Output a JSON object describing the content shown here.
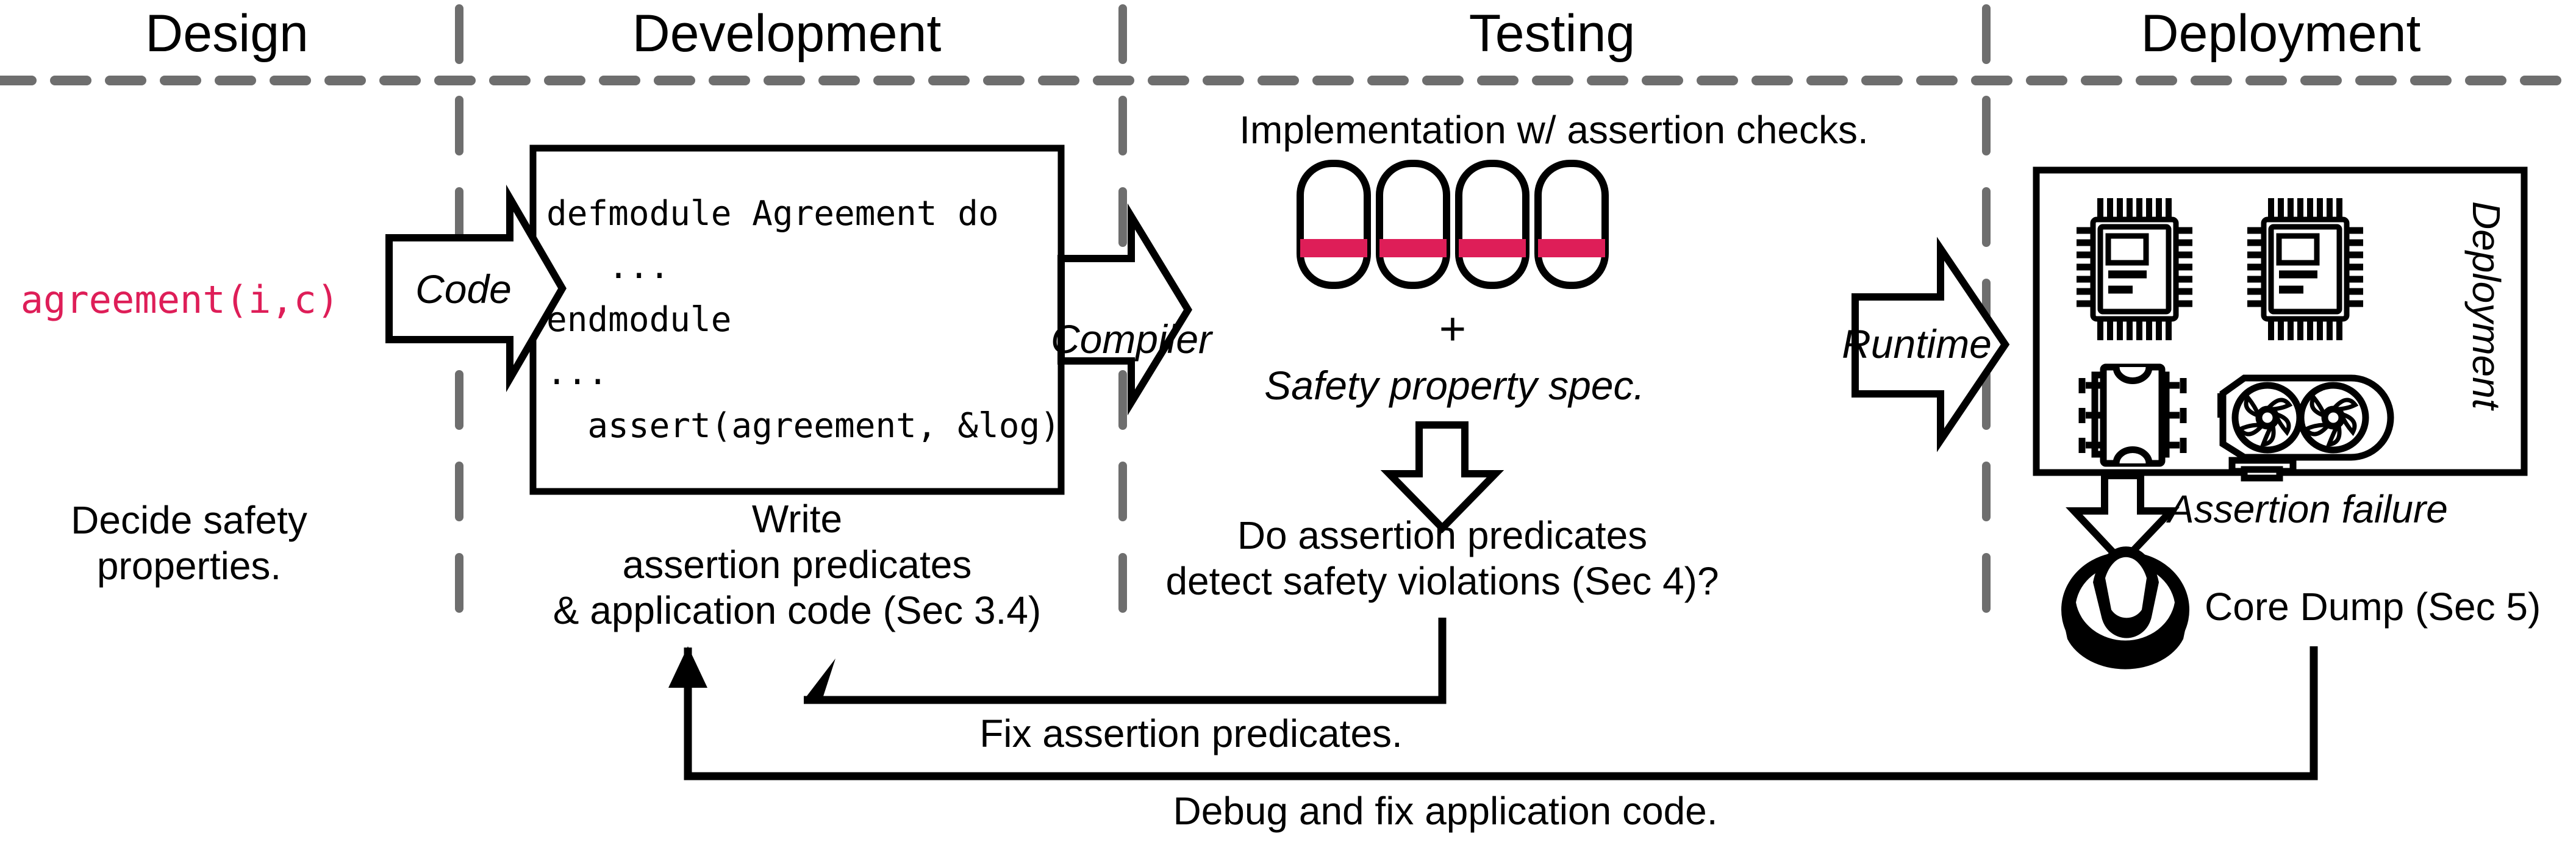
{
  "colors": {
    "accent_crimson": "#DE1E58",
    "divider_gray": "#6E6E6E",
    "stroke_black": "#000000",
    "background": "#FFFFFF"
  },
  "phases": [
    {
      "id": "design",
      "label": "Design"
    },
    {
      "id": "development",
      "label": "Development"
    },
    {
      "id": "testing",
      "label": "Testing"
    },
    {
      "id": "deployment",
      "label": "Deployment"
    }
  ],
  "design": {
    "expression": "agreement(i,c)",
    "caption_line1": "Decide safety",
    "caption_line2": "properties."
  },
  "development": {
    "code_lines": [
      "defmodule Agreement do",
      "   ...",
      "endmodule",
      "...",
      "  assert(agreement, &log)"
    ],
    "caption_line1": "Write",
    "caption_line2": "assertion predicates",
    "caption_line3": "& application code (Sec 3.4)"
  },
  "testing": {
    "heading": "Implementation w/ assertion checks.",
    "plus": "+",
    "spec_label": "Safety property spec.",
    "question_line1": "Do assertion predicates",
    "question_line2": "detect safety violations (Sec 4)?",
    "capsule_count": 4
  },
  "deployment": {
    "vertical_label": "Deployment",
    "failure_label": "Assertion failure",
    "core_dump_label": "Core Dump (Sec 5)"
  },
  "arrows": {
    "code": "Code",
    "compiler": "Compiler",
    "runtime": "Runtime"
  },
  "feedback": {
    "fix_predicates": "Fix assertion predicates.",
    "debug_fix_code": "Debug and fix application code."
  }
}
